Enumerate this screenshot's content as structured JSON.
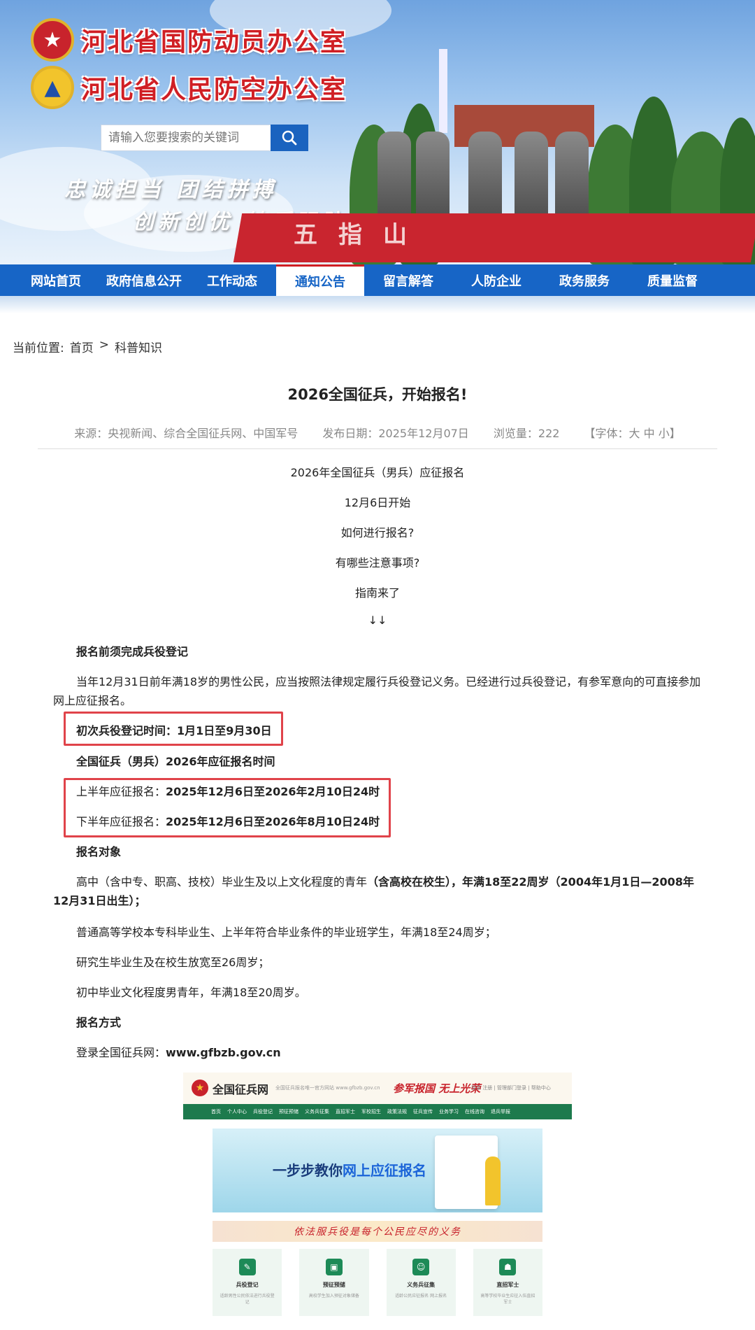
{
  "header": {
    "org1": "河北省国防动员办公室",
    "org2": "河北省人民防空办公室",
    "search_placeholder": "请输入您要搜索的关键词",
    "slogan1": "忠诚担当 团结拼搏",
    "slogan2": "创新创优 铸盾强防"
  },
  "nav": {
    "items": [
      "网站首页",
      "政府信息公开",
      "工作动态",
      "通知公告",
      "留言解答",
      "人防企业",
      "政务服务",
      "质量监督"
    ],
    "active_index": 3
  },
  "breadcrumb": {
    "prefix": "当前位置:",
    "home": "首页",
    "sep": ">",
    "current": "科普知识"
  },
  "article": {
    "title": "2026全国征兵，开始报名!",
    "meta": {
      "source": "来源：央视新闻、综合全国征兵网、中国军号",
      "date": "发布日期：2025年12月07日",
      "views": "浏览量：222",
      "font_size": "【字体：大 中 小】"
    },
    "intro_lines": [
      "2026年全国征兵（男兵）应征报名",
      "12月6日开始",
      "如何进行报名?",
      "有哪些注意事项?",
      "指南来了",
      "↓↓"
    ],
    "s1_heading": "报名前须完成兵役登记",
    "s1_text": "当年12月31日前年满18岁的男性公民，应当按照法律规定履行兵役登记义务。已经进行过兵役登记，有参军意向的可直接参加网上应征报名。",
    "first_reg": "初次兵役登记时间：1月1日至9月30日",
    "s2_heading": "全国征兵（男兵）2026年应征报名时间",
    "first_half_label": "上半年应征报名：",
    "first_half_value": "2025年12月6日至2026年2月10日24时",
    "second_half_label": "下半年应征报名：",
    "second_half_value": "2025年12月6日至2026年8月10日24时",
    "s3_heading": "报名对象",
    "s3_p1_a": "高中（含中专、职高、技校）毕业生及以上文化程度的青年",
    "s3_p1_b": "（含高校在校生），年满18至22周岁（2004年1月1日—2008年12月31日出生）；",
    "s3_p2": "普通高等学校本专科毕业生、上半年符合毕业条件的毕业班学生，年满18至24周岁；",
    "s3_p3": "研究生毕业生及在校生放宽至26周岁；",
    "s3_p4": "初中毕业文化程度男青年，年满18至20周岁。",
    "s4_heading": "报名方式",
    "s4_label": "登录全国征兵网：",
    "s4_url": "www.gfbzb.gov.cn"
  },
  "screenshot": {
    "site_name": "全国征兵网",
    "site_sub": "全国征兵报名唯一官方网站 www.gfbzb.gov.cn",
    "slogan": "参军报国 无上光荣",
    "top_links": "登录 注册 | 管理部门登录 | 帮助中心",
    "nav": [
      "首页",
      "个人中心",
      "兵役登记",
      "预征预储",
      "义务兵征集",
      "直招军士",
      "军校招生",
      "政策法规",
      "征兵宣传",
      "业务学习",
      "在线咨询",
      "退兵举报"
    ],
    "hero_a": "一步步教你",
    "hero_b": "网上应征报名",
    "banner": "依法服兵役是每个公民应尽的义务",
    "cards": [
      {
        "title": "兵役登记",
        "desc": "适龄男性公民依法进行兵役登记"
      },
      {
        "title": "预征预储",
        "desc": "高校学生加入预征对象储备"
      },
      {
        "title": "义务兵征集",
        "desc": "适龄公民应征报名 网上报名"
      },
      {
        "title": "直招军士",
        "desc": "高等学校毕业生应征入伍直招军士"
      }
    ]
  },
  "colors": {
    "nav_blue": "#1765c6",
    "brand_red": "#d01f24",
    "highlight_red": "#e0434a",
    "zbw_green": "#1d7a4d"
  }
}
